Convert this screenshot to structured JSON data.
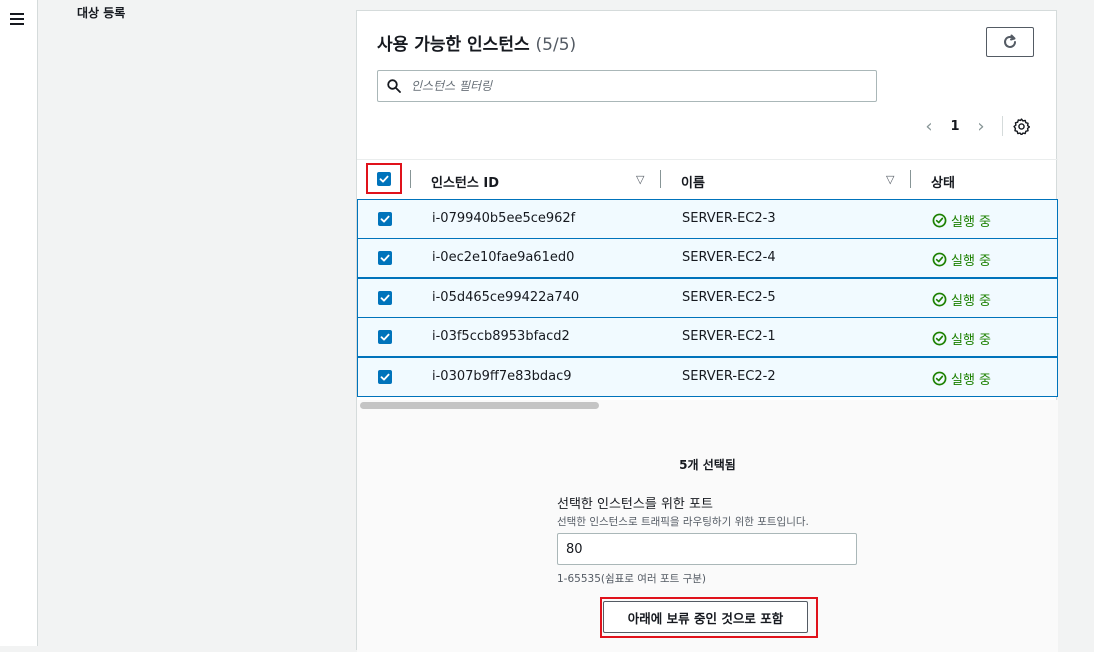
{
  "section": {
    "label": "대상 등록"
  },
  "panel": {
    "title": "사용 가능한 인스턴스",
    "count": "(5/5)",
    "search_placeholder": "인스턴스 필터링",
    "pagination": {
      "page": "1",
      "prev": "‹",
      "next": "›"
    }
  },
  "table": {
    "columns": [
      "인스턴스 ID",
      "이름",
      "상태"
    ],
    "rows": [
      {
        "id": "i-079940b5ee5ce962f",
        "name": "SERVER-EC2-3",
        "status": "실행 중"
      },
      {
        "id": "i-0ec2e10fae9a61ed0",
        "name": "SERVER-EC2-4",
        "status": "실행 중"
      },
      {
        "id": "i-05d465ce99422a740",
        "name": "SERVER-EC2-5",
        "status": "실행 중"
      },
      {
        "id": "i-03f5ccb8953bfacd2",
        "name": "SERVER-EC2-1",
        "status": "실행 중"
      },
      {
        "id": "i-0307b9ff7e83bdac9",
        "name": "SERVER-EC2-2",
        "status": "실행 중"
      }
    ]
  },
  "footer": {
    "selected_count": "5개 선택됨",
    "port_label": "선택한 인스턴스를 위한 포트",
    "port_description": "선택한 인스턴스로 트래픽을 라우팅하기 위한 포트입니다.",
    "port_value": "80",
    "port_hint": "1-65535(쉼표로 여러 포트 구분)",
    "include_button": "아래에 보류 중인 것으로 포함"
  },
  "colors": {
    "accent": "#0073bb",
    "running": "#1d8102",
    "highlight": "#e0121b",
    "row_selected_bg": "#f1faff"
  }
}
